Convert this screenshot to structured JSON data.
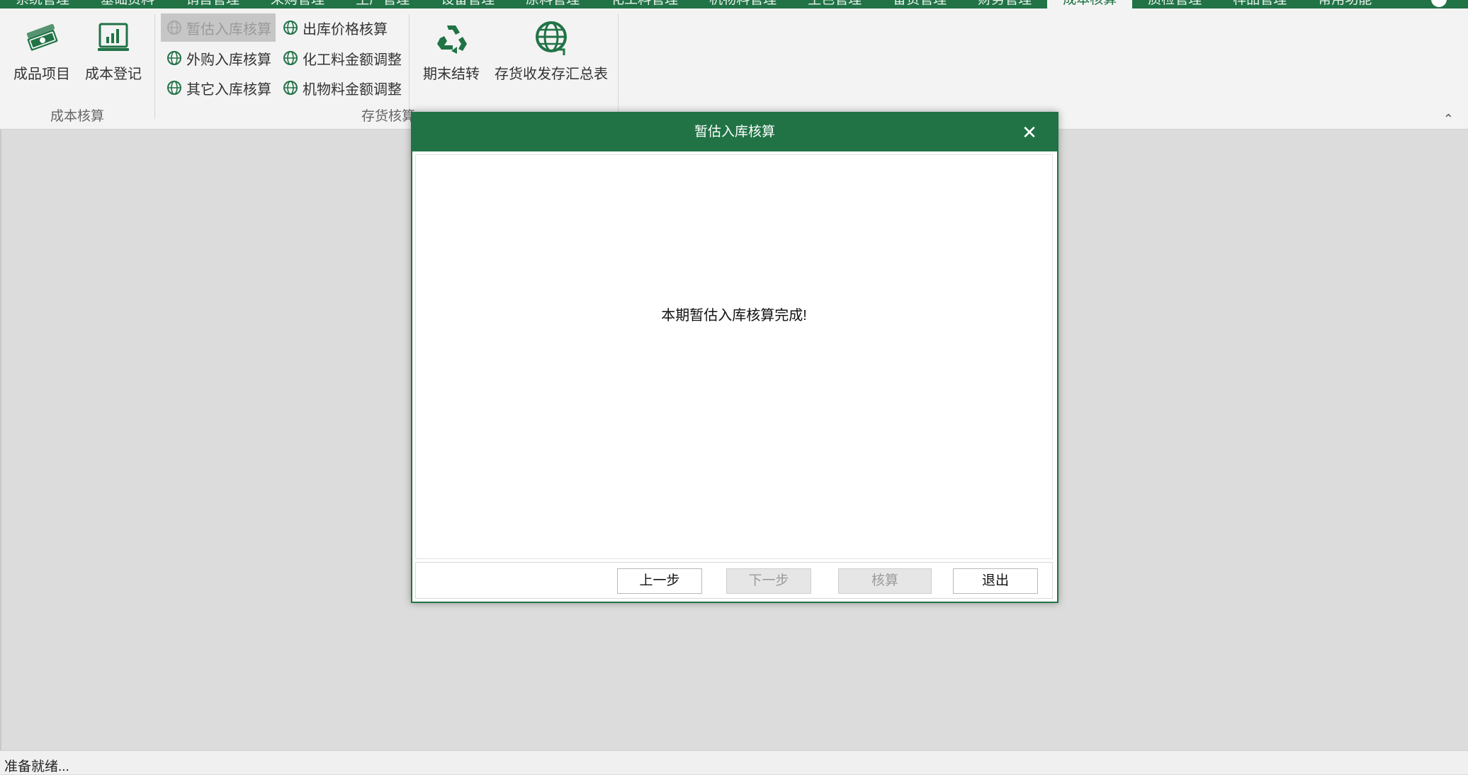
{
  "menubar": {
    "tabs": [
      "系统管理",
      "基础资料",
      "销售管理",
      "采购管理",
      "生产管理",
      "设备管理",
      "原料管理",
      "化工料管理",
      "机物料管理",
      "生色管理",
      "备货管理",
      "财务管理",
      "成本核算",
      "质检管理",
      "样品管理",
      "常用功能"
    ],
    "active_tab": "成本核算"
  },
  "ribbon": {
    "group1": {
      "label": "成本核算",
      "buttons": [
        {
          "label": "成品项目",
          "icon": "money-icon"
        },
        {
          "label": "成本登记",
          "icon": "chart-monitor-icon"
        }
      ]
    },
    "group2": {
      "label": "存货核算",
      "small_buttons": [
        {
          "label": "暂估入库核算",
          "icon": "globe-icon",
          "disabled": true
        },
        {
          "label": "外购入库核算",
          "icon": "globe-icon"
        },
        {
          "label": "其它入库核算",
          "icon": "globe-icon"
        },
        {
          "label": "出库价格核算",
          "icon": "globe-icon"
        },
        {
          "label": "化工料金额调整",
          "icon": "globe-icon"
        },
        {
          "label": "机物料金额调整",
          "icon": "globe-icon"
        }
      ],
      "big_buttons": [
        {
          "label": "期末结转",
          "icon": "recycle-icon"
        },
        {
          "label": "存货收发存汇总表",
          "icon": "globe-refresh-icon"
        }
      ]
    }
  },
  "dialog": {
    "title": "暂估入库核算",
    "message": "本期暂估入库核算完成!",
    "buttons": {
      "prev": "上一步",
      "next": "下一步",
      "calc": "核算",
      "exit": "退出"
    }
  },
  "status": {
    "text": "准备就绪..."
  },
  "colors": {
    "accent": "#217346",
    "ribbon_bg": "#f3f3f3",
    "workspace_bg": "#dcdcdc"
  }
}
